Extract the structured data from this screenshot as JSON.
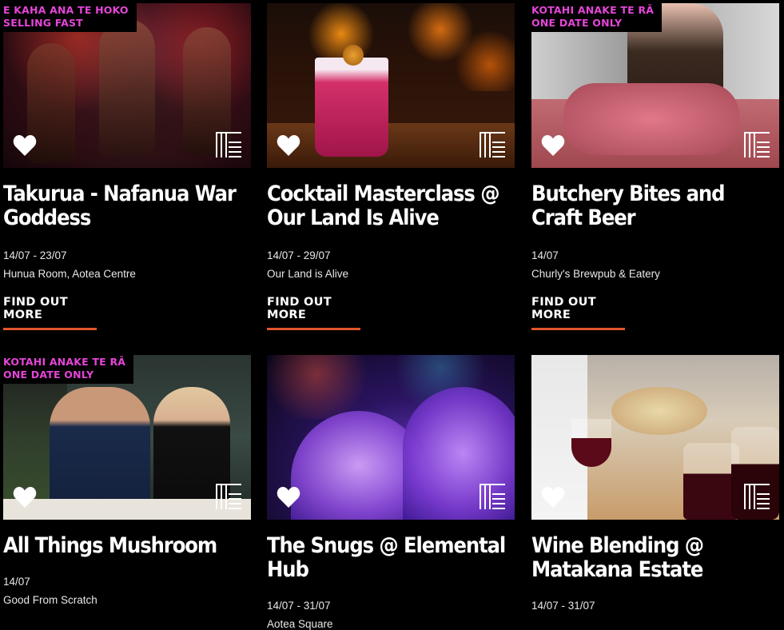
{
  "cards": [
    {
      "badge": "E KAHA ANA TE HOKO\nSELLING FAST",
      "badge_l1": "E KAHA ANA TE HOKO",
      "badge_l2": "SELLING FAST",
      "title": "Takurua - Nafanua War Goddess",
      "date": "14/07 - 23/07",
      "venue": "Hunua Room, Aotea Centre",
      "cta": "FIND OUT MORE"
    },
    {
      "badge_l1": "",
      "badge_l2": "",
      "title": "Cocktail Masterclass @ Our Land Is Alive",
      "date": "14/07 - 29/07",
      "venue": "Our Land is Alive",
      "cta": "FIND OUT MORE"
    },
    {
      "badge_l1": "KOTAHI ANAKE TE RĀ",
      "badge_l2": "ONE DATE ONLY",
      "title": "Butchery Bites and Craft Beer",
      "date": "14/07",
      "venue": "Churly's Brewpub & Eatery",
      "cta": "FIND OUT MORE"
    },
    {
      "badge_l1": "KOTAHI ANAKE TE RĀ",
      "badge_l2": "ONE DATE ONLY",
      "title": "All Things Mushroom",
      "date": "14/07",
      "venue": "Good From Scratch",
      "cta": ""
    },
    {
      "badge_l1": "",
      "badge_l2": "",
      "title": "The Snugs @ Elemental Hub",
      "date": "14/07 - 31/07",
      "venue": "Aotea Square",
      "cta": ""
    },
    {
      "badge_l1": "",
      "badge_l2": "",
      "title": "Wine Blending @ Matakana Estate",
      "date": "14/07 - 31/07",
      "venue": "",
      "cta": ""
    }
  ],
  "colors": {
    "badge": "#e545d8",
    "accent": "#e0562c",
    "background": "#000000"
  },
  "icons": {
    "favorite": "heart-icon",
    "category": "grid-lines-icon"
  }
}
